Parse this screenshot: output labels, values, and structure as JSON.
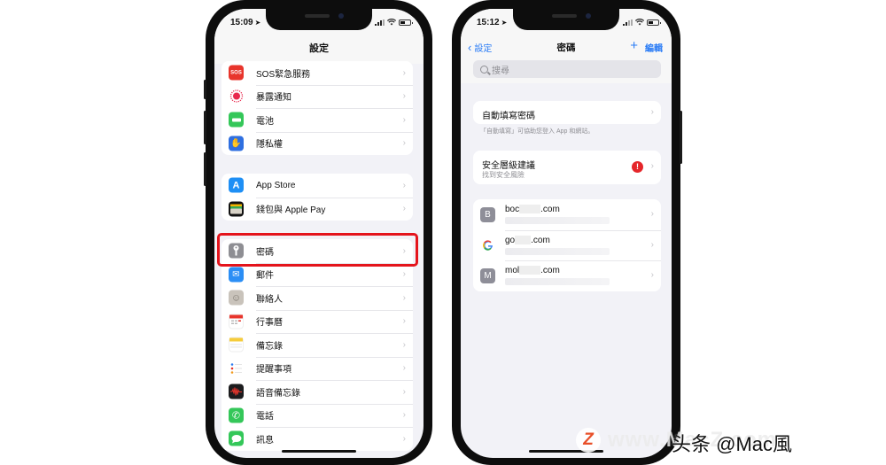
{
  "left_phone": {
    "status_time": "15:09",
    "nav_title": "設定",
    "groups": [
      [
        {
          "label": "SOS緊急服務",
          "icon": "sos-icon",
          "icon_text": "SOS",
          "color": "#e8352c"
        },
        {
          "label": "暴露通知",
          "icon": "exposure-notification-icon",
          "icon_text": "",
          "color": "#ffffff"
        },
        {
          "label": "電池",
          "icon": "battery-icon",
          "icon_text": "",
          "color": "#34c759"
        },
        {
          "label": "隱私權",
          "icon": "privacy-hand-icon",
          "icon_text": "✋",
          "color": "#2f6fe0"
        }
      ],
      [
        {
          "label": "App Store",
          "icon": "app-store-icon",
          "icon_text": "A",
          "color": "#1e8ff5"
        },
        {
          "label": "錢包與 Apple Pay",
          "icon": "wallet-icon",
          "icon_text": "",
          "color": "#111111"
        }
      ],
      [
        {
          "label": "密碼",
          "icon": "key-icon",
          "icon_text": "⚷",
          "color": "#8e8e93"
        },
        {
          "label": "郵件",
          "icon": "mail-icon",
          "icon_text": "✉",
          "color": "#2b8ef5"
        },
        {
          "label": "聯絡人",
          "icon": "contacts-icon",
          "icon_text": "☺",
          "color": "#b8b2aa"
        },
        {
          "label": "行事曆",
          "icon": "calendar-icon",
          "icon_text": "",
          "color": "#ffffff"
        },
        {
          "label": "備忘錄",
          "icon": "notes-icon",
          "icon_text": "",
          "color": "#ffffff"
        },
        {
          "label": "提醒事項",
          "icon": "reminders-icon",
          "icon_text": "",
          "color": "#ffffff"
        },
        {
          "label": "語音備忘錄",
          "icon": "voice-memos-icon",
          "icon_text": "",
          "color": "#1c1c1e"
        },
        {
          "label": "電話",
          "icon": "phone-icon",
          "icon_text": "✆",
          "color": "#34c759"
        },
        {
          "label": "訊息",
          "icon": "messages-icon",
          "icon_text": "",
          "color": "#34c759"
        }
      ]
    ],
    "highlighted_item": "密碼"
  },
  "right_phone": {
    "status_time": "15:12",
    "back_label": "設定",
    "nav_title": "密碼",
    "add_label": "+",
    "edit_label": "編輯",
    "search_placeholder": "搜尋",
    "autofill_label": "自動填寫密碼",
    "autofill_footnote": "「自動填寫」可協助您登入 App 和網站。",
    "security_label": "安全層級建議",
    "security_sub": "找到安全風險",
    "security_alert": "!",
    "accounts": [
      {
        "avatar": "B",
        "site_prefix": "boc",
        "site_suffix": ".com"
      },
      {
        "avatar": "G",
        "site_prefix": "go",
        "site_suffix": ".com"
      },
      {
        "avatar": "M",
        "site_prefix": "mol",
        "site_suffix": ".com"
      }
    ]
  },
  "accent_color": "#2a7cf6",
  "highlight_color": "#e4141c",
  "watermark": {
    "logo": "Z",
    "url": "www.MacZ.com",
    "credit": "头条 @Mac風"
  }
}
